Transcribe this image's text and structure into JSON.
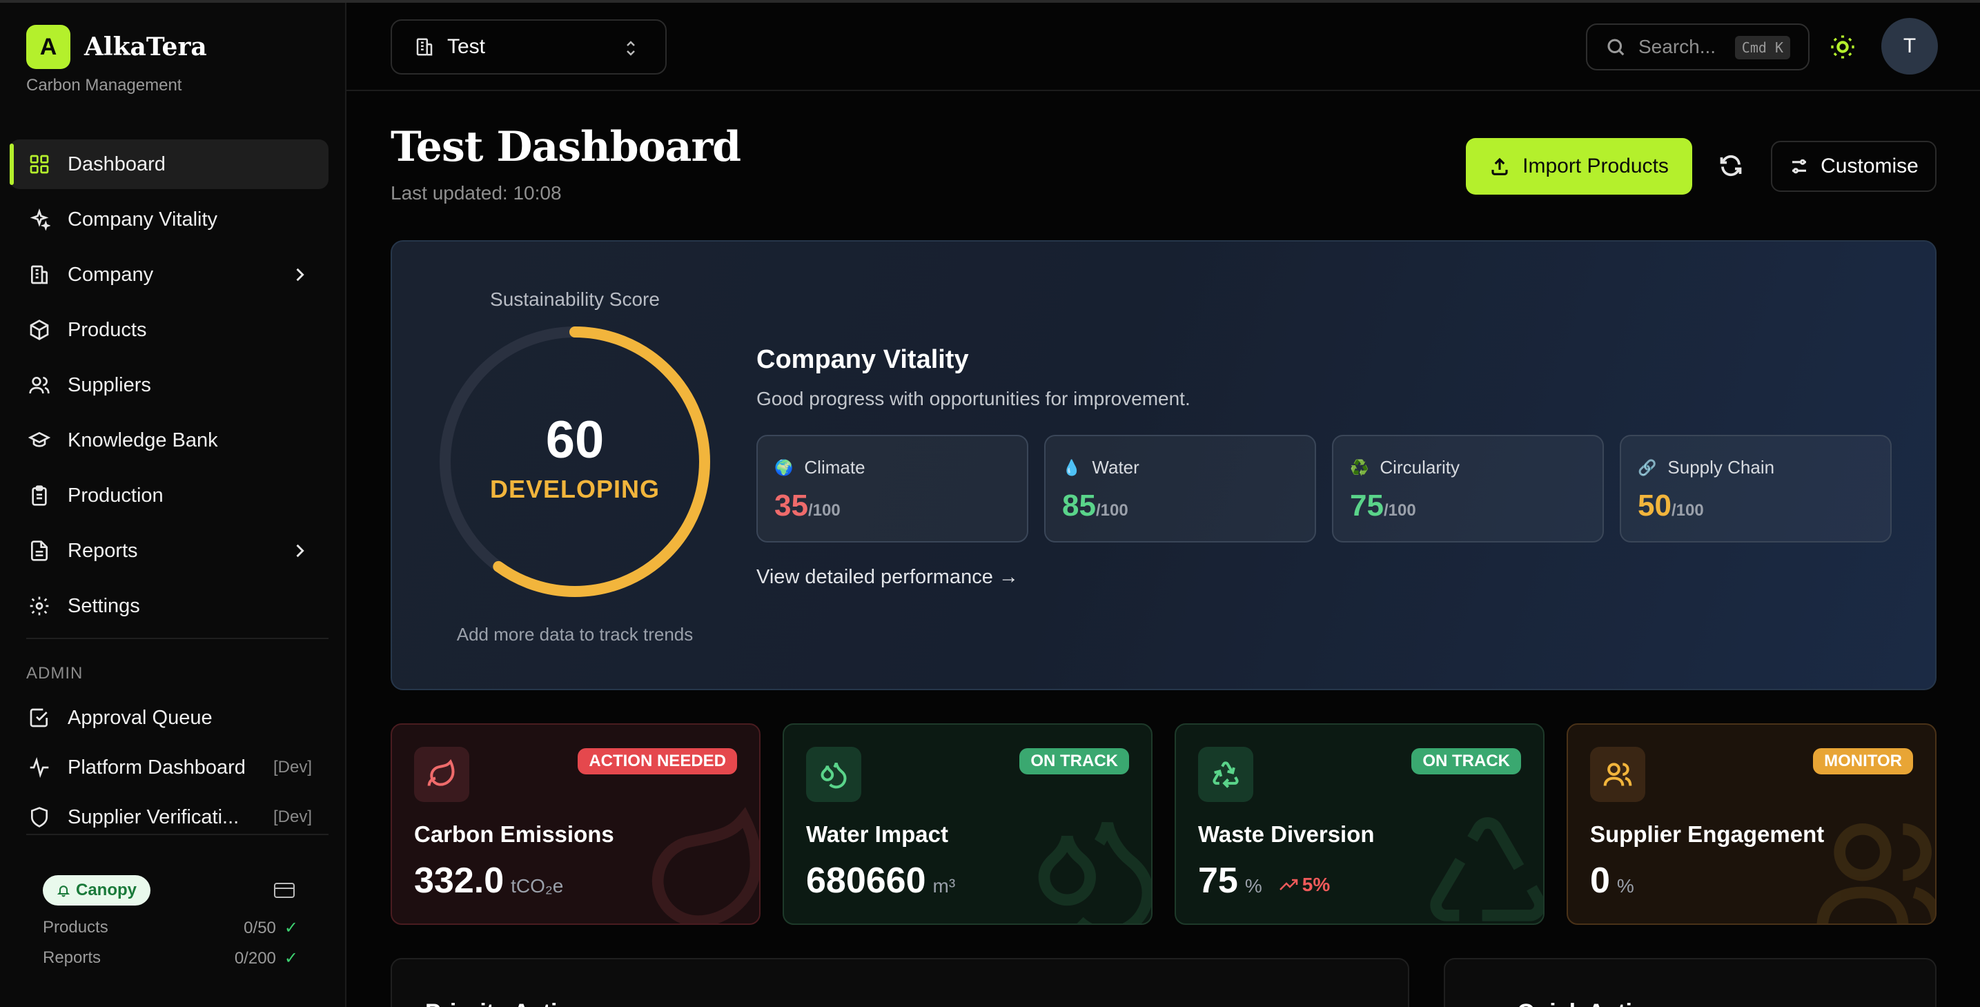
{
  "brand": {
    "logo_letter": "A",
    "name": "AlkaTera",
    "subtitle": "Carbon Management"
  },
  "nav": [
    {
      "label": "Dashboard",
      "icon": "layout-grid-icon",
      "active": true
    },
    {
      "label": "Company Vitality",
      "icon": "sparkles-icon"
    },
    {
      "label": "Company",
      "icon": "building-icon",
      "has_children": true
    },
    {
      "label": "Products",
      "icon": "package-icon"
    },
    {
      "label": "Suppliers",
      "icon": "users-icon"
    },
    {
      "label": "Knowledge Bank",
      "icon": "graduation-cap-icon"
    },
    {
      "label": "Production",
      "icon": "clipboard-icon"
    },
    {
      "label": "Reports",
      "icon": "file-text-icon",
      "has_children": true
    },
    {
      "label": "Settings",
      "icon": "gear-icon"
    }
  ],
  "admin": {
    "section_label": "ADMIN",
    "items": [
      {
        "label": "Approval Queue",
        "icon": "check-square-icon",
        "tag": ""
      },
      {
        "label": "Platform Dashboard",
        "icon": "activity-icon",
        "tag": "[Dev]"
      },
      {
        "label": "Supplier Verificati...",
        "icon": "shield-icon",
        "tag": "[Dev]"
      }
    ]
  },
  "plan": {
    "name": "Canopy",
    "rows": [
      {
        "label": "Products",
        "value": "0/50",
        "mark": "✓"
      },
      {
        "label": "Reports",
        "value": "0/200",
        "mark": "✓"
      }
    ]
  },
  "header": {
    "org_name": "Test",
    "search_placeholder": "Search...",
    "search_shortcut": "Cmd K",
    "avatar_letter": "T"
  },
  "page": {
    "title": "Test Dashboard",
    "last_updated": "Last updated: 10:08",
    "import_label": "Import Products",
    "customise_label": "Customise"
  },
  "vitality": {
    "score_label": "Sustainability Score",
    "score": "60",
    "score_value": 60,
    "score_max": 100,
    "status": "DEVELOPING",
    "hint": "Add more data to track trends",
    "title": "Company Vitality",
    "description": "Good progress with opportunities for improvement.",
    "link": "View detailed performance →",
    "gauge_color": "#f2b53c",
    "metrics": [
      {
        "name": "Climate",
        "icon": "🌍",
        "value": "35",
        "max": "/100",
        "color": "#ef6b6b"
      },
      {
        "name": "Water",
        "icon": "💧",
        "value": "85",
        "max": "/100",
        "color": "#5ad48a"
      },
      {
        "name": "Circularity",
        "icon": "♻️",
        "value": "75",
        "max": "/100",
        "color": "#5ad48a"
      },
      {
        "name": "Supply Chain",
        "icon": "🔗",
        "value": "50",
        "max": "/100",
        "color": "#f2b53c"
      }
    ]
  },
  "kpis": [
    {
      "title": "Carbon Emissions",
      "badge": "ACTION NEEDED",
      "value": "332.0",
      "unit": "tCO₂e",
      "trend": "",
      "badge_color": "#e5484d",
      "accent": "#ef6b6b",
      "bg": "#1d0e10",
      "border": "#4a1c20",
      "icon_bg": "#3a1a1e",
      "icon": "leaf-icon"
    },
    {
      "title": "Water Impact",
      "badge": "ON TRACK",
      "value": "680660",
      "unit": "m³",
      "trend": "",
      "badge_color": "#3aa870",
      "accent": "#5ad48a",
      "bg": "#0c1a13",
      "border": "#1e3a2a",
      "icon_bg": "#163a28",
      "icon": "droplets-icon"
    },
    {
      "title": "Waste Diversion",
      "badge": "ON TRACK",
      "value": "75",
      "unit": "%",
      "trend": "5%",
      "badge_color": "#3aa870",
      "accent": "#5ad48a",
      "bg": "#0c1a13",
      "border": "#1e3a2a",
      "icon_bg": "#163a28",
      "icon": "recycle-icon"
    },
    {
      "title": "Supplier Engagement",
      "badge": "MONITOR",
      "value": "0",
      "unit": "%",
      "trend": "",
      "badge_color": "#e8a535",
      "accent": "#f2b53c",
      "bg": "#1c130b",
      "border": "#4a3218",
      "icon_bg": "#3a2614",
      "icon": "users-icon"
    }
  ],
  "bottom": {
    "left_title": "Priority Actions",
    "right_title": "Quick Actions"
  }
}
